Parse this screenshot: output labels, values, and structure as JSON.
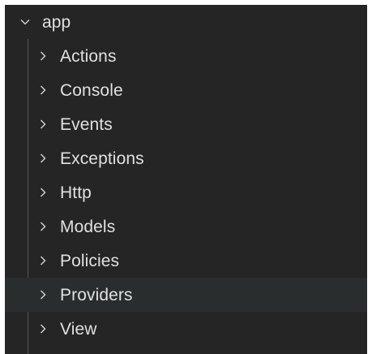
{
  "explorer": {
    "root": {
      "label": "app",
      "expanded": true,
      "icon": "chevron-down-icon"
    },
    "items": [
      {
        "label": "Actions",
        "icon": "chevron-right-icon"
      },
      {
        "label": "Console",
        "icon": "chevron-right-icon"
      },
      {
        "label": "Events",
        "icon": "chevron-right-icon"
      },
      {
        "label": "Exceptions",
        "icon": "chevron-right-icon"
      },
      {
        "label": "Http",
        "icon": "chevron-right-icon"
      },
      {
        "label": "Models",
        "icon": "chevron-right-icon"
      },
      {
        "label": "Policies",
        "icon": "chevron-right-icon"
      },
      {
        "label": "Providers",
        "icon": "chevron-right-icon",
        "hovered": true
      },
      {
        "label": "View",
        "icon": "chevron-right-icon"
      }
    ]
  },
  "colors": {
    "background": "#252526",
    "hover": "#2a2d2e",
    "text": "#e0e0e0",
    "indent_guide": "#585858"
  }
}
